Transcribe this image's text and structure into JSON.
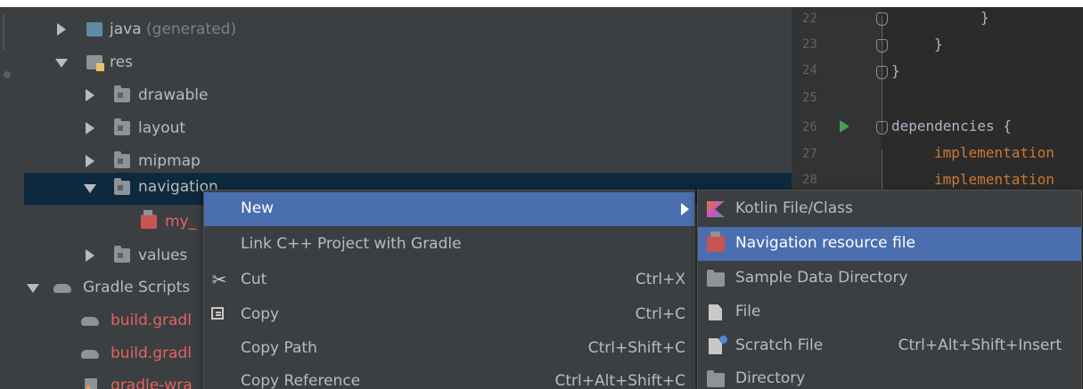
{
  "tree": {
    "items": [
      {
        "label": "java",
        "suffix": " (generated)"
      },
      {
        "label": "res"
      },
      {
        "label": "drawable"
      },
      {
        "label": "layout"
      },
      {
        "label": "mipmap"
      },
      {
        "label": "navigation"
      },
      {
        "label": "my_"
      },
      {
        "label": "values"
      },
      {
        "label": "Gradle Scripts"
      },
      {
        "label": "build.gradl"
      },
      {
        "label": "build.gradl"
      },
      {
        "label": "gradle-wra"
      }
    ]
  },
  "editor": {
    "line_numbers": [
      "22",
      "23",
      "24",
      "25",
      "26",
      "27",
      "28"
    ],
    "lines": [
      "}",
      "}",
      "}",
      "dependencies {",
      "implementation",
      "implementation"
    ]
  },
  "context_menu": {
    "items": [
      {
        "label": "New",
        "shortcut": ""
      },
      {
        "label": "Link C++ Project with Gradle",
        "shortcut": ""
      },
      {
        "label": "Cut",
        "shortcut": "Ctrl+X"
      },
      {
        "label": "Copy",
        "shortcut": "Ctrl+C"
      },
      {
        "label": "Copy Path",
        "shortcut": "Ctrl+Shift+C"
      },
      {
        "label": "Copy Reference",
        "shortcut": "Ctrl+Alt+Shift+C"
      }
    ]
  },
  "submenu": {
    "items": [
      {
        "label": "Kotlin File/Class",
        "shortcut": ""
      },
      {
        "label": "Navigation resource file",
        "shortcut": ""
      },
      {
        "label": "Sample Data Directory",
        "shortcut": ""
      },
      {
        "label": "File",
        "shortcut": ""
      },
      {
        "label": "Scratch File",
        "shortcut": "Ctrl+Alt+Shift+Insert"
      },
      {
        "label": "Directory",
        "shortcut": ""
      }
    ]
  },
  "colors": {
    "panel_bg": "#3c3f41",
    "editor_bg": "#2b2b2b",
    "selection": "#0d293e",
    "menu_highlight": "#4b6eaf",
    "vcs_red": "#e0645f"
  }
}
